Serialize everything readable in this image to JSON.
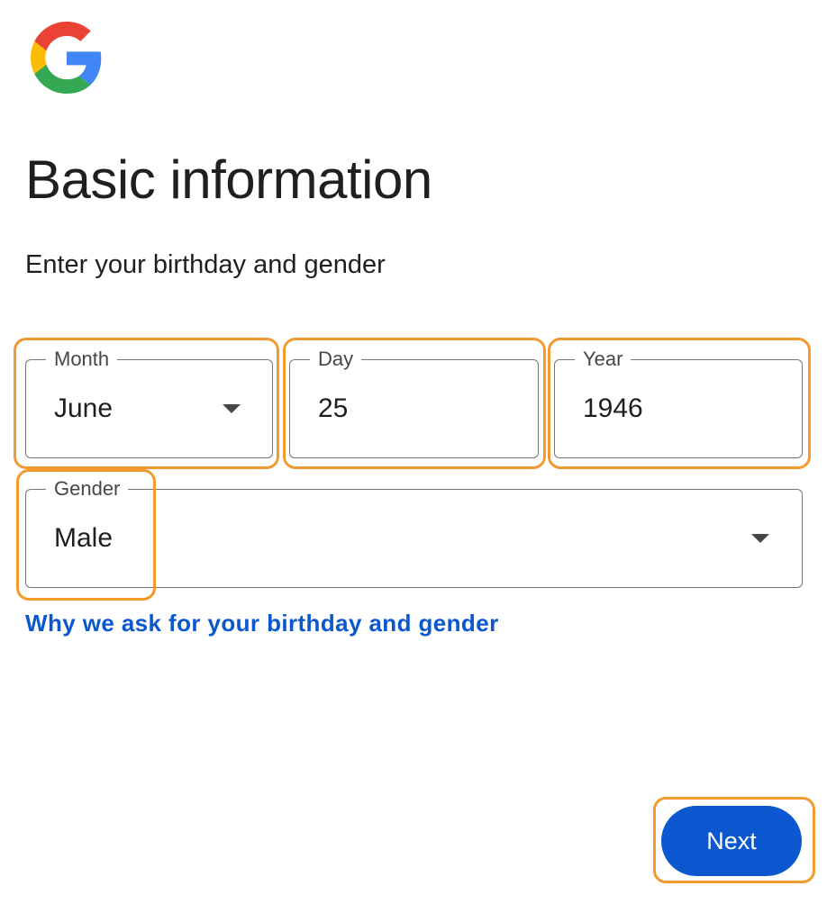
{
  "logo": {
    "icon": "google-g-logo",
    "colors": {
      "red": "#EA4335",
      "yellow": "#FBBC05",
      "green": "#34A853",
      "blue": "#4285F4"
    }
  },
  "header": {
    "title": "Basic information",
    "subtitle": "Enter your birthday and gender"
  },
  "form": {
    "month": {
      "label": "Month",
      "value": "June"
    },
    "day": {
      "label": "Day",
      "value": "25"
    },
    "year": {
      "label": "Year",
      "value": "1946"
    },
    "gender": {
      "label": "Gender",
      "value": "Male"
    }
  },
  "help_link": "Why we ask for your birthday and gender",
  "actions": {
    "next_label": "Next"
  },
  "colors": {
    "accent": "#0b57d0",
    "highlight": "#f29a2e",
    "border": "#747775"
  }
}
